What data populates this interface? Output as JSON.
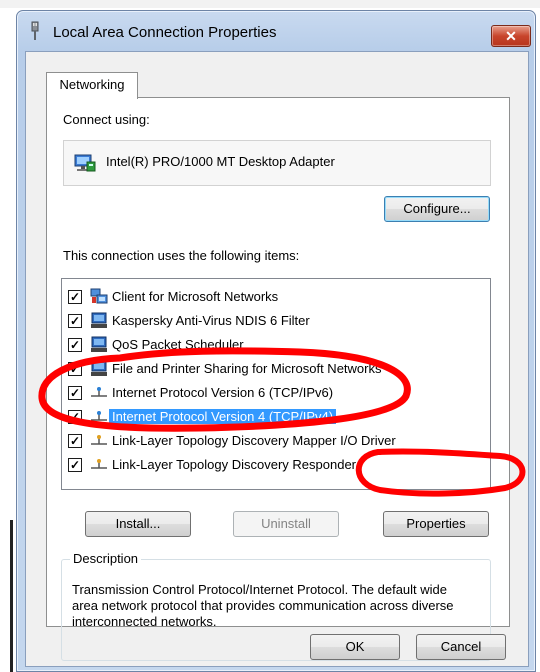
{
  "window": {
    "title": "Local Area Connection Properties",
    "close_label": "✕"
  },
  "tabs": [
    {
      "label": "Networking",
      "active": true
    }
  ],
  "connect_using": {
    "label": "Connect using:",
    "adapter": "Intel(R) PRO/1000 MT Desktop Adapter",
    "configure_label": "Configure..."
  },
  "items": {
    "label": "This connection uses the following items:",
    "list": [
      {
        "label": "Client for Microsoft Networks",
        "checked": true,
        "icon": "network-client-icon",
        "selected": false
      },
      {
        "label": "Kaspersky Anti-Virus NDIS 6 Filter",
        "checked": true,
        "icon": "network-service-icon",
        "selected": false
      },
      {
        "label": "QoS Packet Scheduler",
        "checked": true,
        "icon": "network-service-icon",
        "selected": false
      },
      {
        "label": "File and Printer Sharing for Microsoft Networks",
        "checked": true,
        "icon": "network-service-icon",
        "selected": false
      },
      {
        "label": "Internet Protocol Version 6 (TCP/IPv6)",
        "checked": true,
        "icon": "protocol-icon",
        "selected": false
      },
      {
        "label": "Internet Protocol Version 4 (TCP/IPv4)",
        "checked": true,
        "icon": "protocol-icon",
        "selected": true
      },
      {
        "label": "Link-Layer Topology Discovery Mapper I/O Driver",
        "checked": true,
        "icon": "protocol-icon",
        "selected": false
      },
      {
        "label": "Link-Layer Topology Discovery Responder",
        "checked": true,
        "icon": "protocol-icon",
        "selected": false
      }
    ]
  },
  "buttons": {
    "install": "Install...",
    "uninstall": "Uninstall",
    "properties": "Properties",
    "ok": "OK",
    "cancel": "Cancel"
  },
  "description": {
    "legend": "Description",
    "text": "Transmission Control Protocol/Internet Protocol. The default wide area network protocol that provides communication across diverse interconnected networks."
  },
  "colors": {
    "selection": "#3399ff",
    "annotation": "#ff0000",
    "title_bar": "#b7cde9"
  }
}
